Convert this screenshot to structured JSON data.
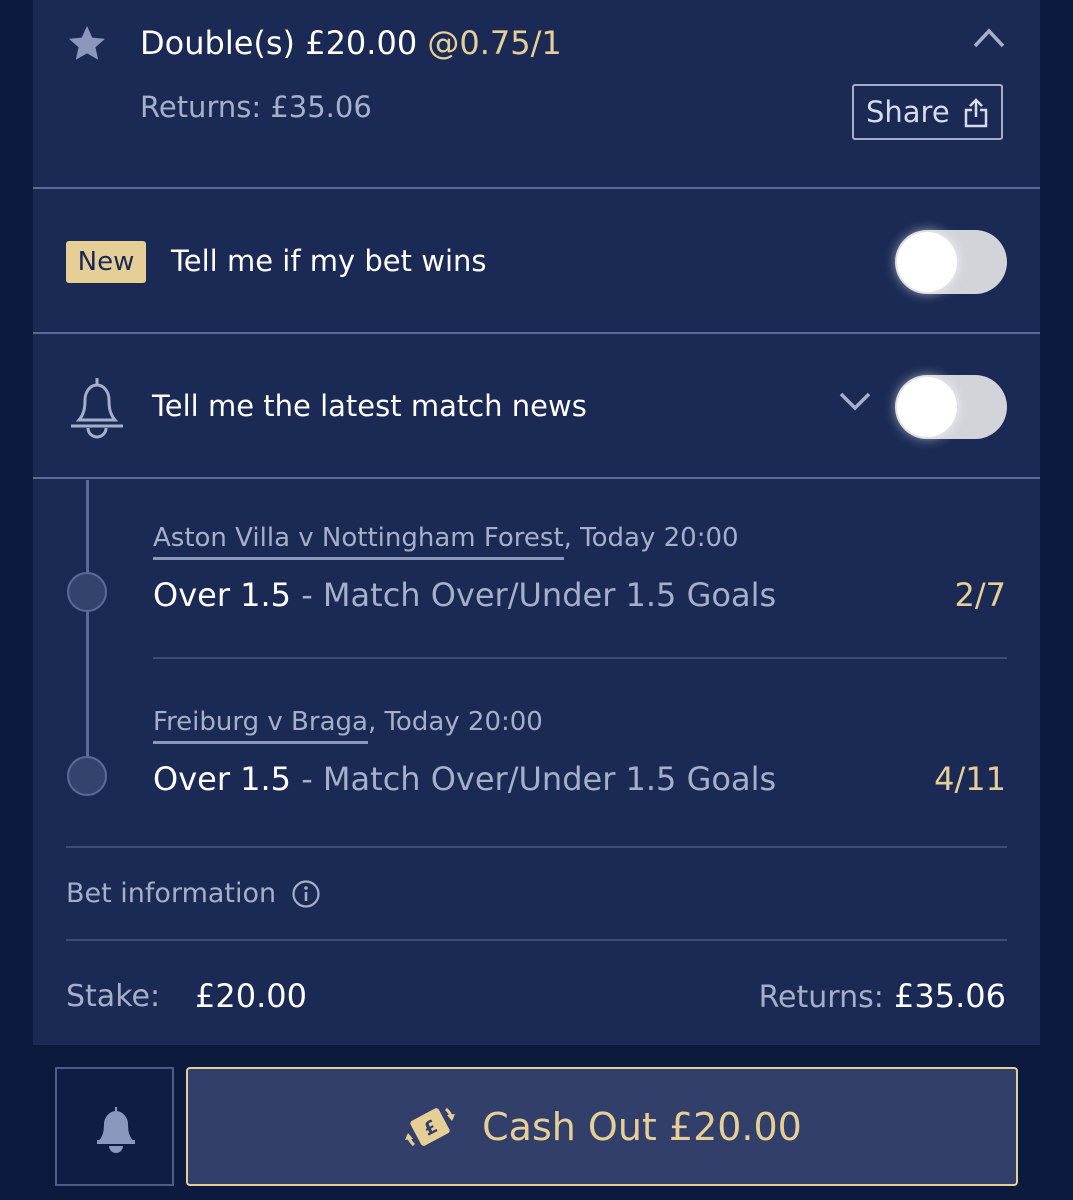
{
  "header": {
    "title": "Double(s) £20.00",
    "odds": "@0.75/1",
    "returns": "Returns: £35.06",
    "share_label": "Share"
  },
  "win_alert": {
    "badge": "New",
    "label": "Tell me if my bet wins",
    "enabled": false
  },
  "news_alert": {
    "label": "Tell me the latest match news",
    "enabled": false
  },
  "legs": [
    {
      "event": "Aston Villa v Nottingham Forest",
      "time": ", Today 20:00",
      "selection": "Over 1.5",
      "market": " - Match Over/Under 1.5 Goals",
      "odds": "2/7"
    },
    {
      "event": "Freiburg v Braga",
      "time": ", Today 20:00",
      "selection": "Over 1.5",
      "market": " - Match Over/Under 1.5 Goals",
      "odds": "4/11"
    }
  ],
  "bet_info": {
    "label": "Bet information"
  },
  "summary": {
    "stake_label": "Stake:",
    "stake_value": "£20.00",
    "returns_label": "Returns:",
    "returns_value": "£35.06"
  },
  "cashout": {
    "label": "Cash Out £20.00"
  },
  "colors": {
    "background": "#0c1a3e",
    "card": "#1b2a55",
    "accent_gold": "#e6cf96",
    "muted_text": "#a6afc9"
  }
}
